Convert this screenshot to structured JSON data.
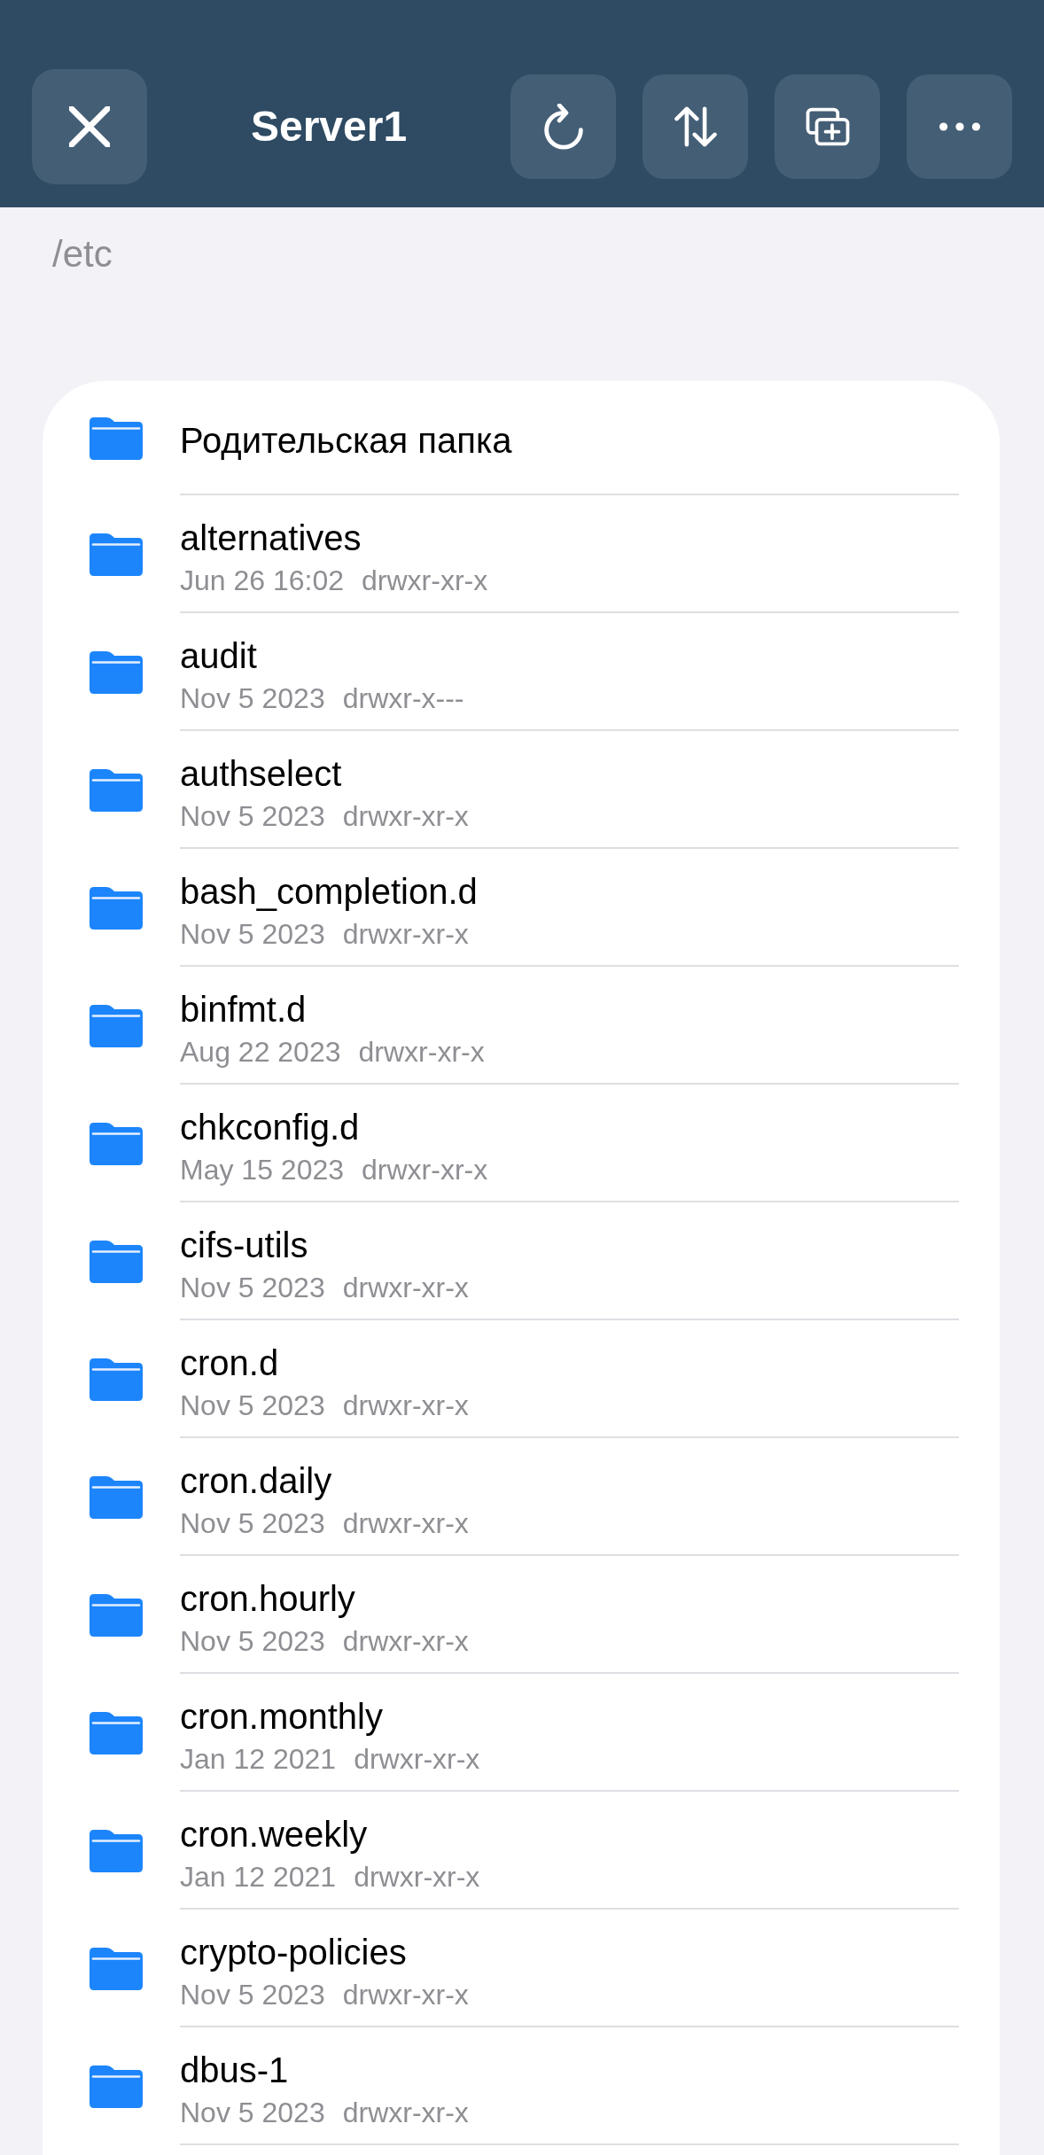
{
  "header": {
    "leading_button": {
      "kind": "close"
    },
    "title": "Server1",
    "trailing_buttons": [
      {
        "kind": "refresh"
      },
      {
        "kind": "sort"
      },
      {
        "kind": "new-window"
      },
      {
        "kind": "more"
      }
    ]
  },
  "path": "/etc",
  "parent_folder": {
    "label": "Родительская папка"
  },
  "folders": [
    {
      "name": "alternatives",
      "modified": "Jun 26 16:02",
      "permissions": "drwxr-xr-x"
    },
    {
      "name": "audit",
      "modified": "Nov 5 2023",
      "permissions": "drwxr-x---"
    },
    {
      "name": "authselect",
      "modified": "Nov 5 2023",
      "permissions": "drwxr-xr-x"
    },
    {
      "name": "bash_completion.d",
      "modified": "Nov 5 2023",
      "permissions": "drwxr-xr-x"
    },
    {
      "name": "binfmt.d",
      "modified": "Aug 22 2023",
      "permissions": "drwxr-xr-x"
    },
    {
      "name": "chkconfig.d",
      "modified": "May 15 2023",
      "permissions": "drwxr-xr-x"
    },
    {
      "name": "cifs-utils",
      "modified": "Nov 5 2023",
      "permissions": "drwxr-xr-x"
    },
    {
      "name": "cron.d",
      "modified": "Nov 5 2023",
      "permissions": "drwxr-xr-x"
    },
    {
      "name": "cron.daily",
      "modified": "Nov 5 2023",
      "permissions": "drwxr-xr-x"
    },
    {
      "name": "cron.hourly",
      "modified": "Nov 5 2023",
      "permissions": "drwxr-xr-x"
    },
    {
      "name": "cron.monthly",
      "modified": "Jan 12 2021",
      "permissions": "drwxr-xr-x"
    },
    {
      "name": "cron.weekly",
      "modified": "Jan 12 2021",
      "permissions": "drwxr-xr-x"
    },
    {
      "name": "crypto-policies",
      "modified": "Nov 5 2023",
      "permissions": "drwxr-xr-x"
    },
    {
      "name": "dbus-1",
      "modified": "Nov 5 2023",
      "permissions": "drwxr-xr-x"
    }
  ]
}
